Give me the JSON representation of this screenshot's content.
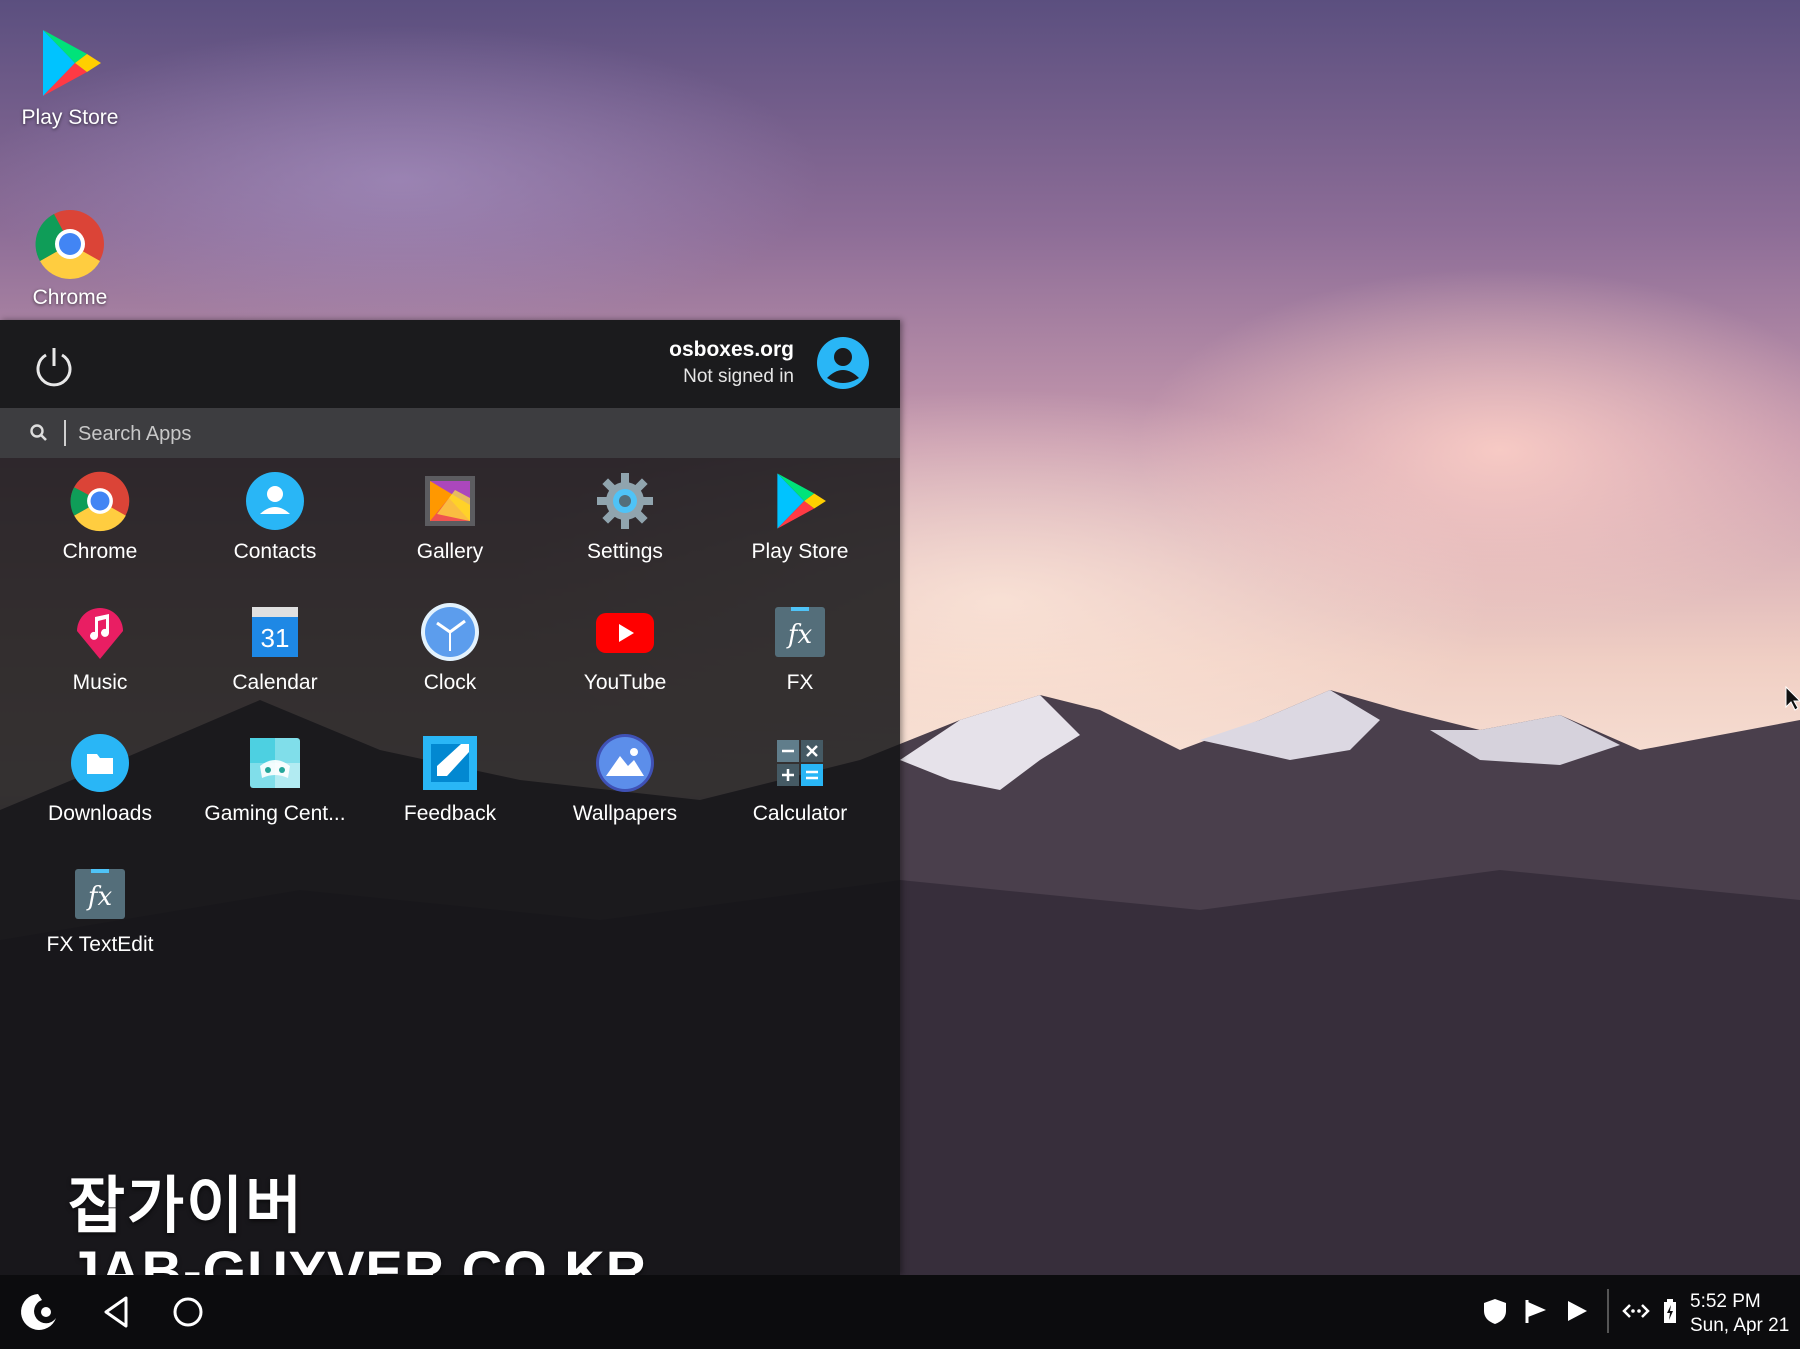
{
  "desktop": {
    "icons": [
      {
        "label": "Play Store",
        "icon": "play-store-icon"
      },
      {
        "label": "Chrome",
        "icon": "chrome-icon"
      }
    ]
  },
  "start_menu": {
    "user": {
      "name": "osboxes.org",
      "status": "Not signed in"
    },
    "search": {
      "placeholder": "Search Apps",
      "value": ""
    },
    "apps": [
      {
        "label": "Chrome",
        "icon": "chrome-icon"
      },
      {
        "label": "Contacts",
        "icon": "contacts-icon"
      },
      {
        "label": "Gallery",
        "icon": "gallery-icon"
      },
      {
        "label": "Settings",
        "icon": "settings-gear-icon"
      },
      {
        "label": "Play Store",
        "icon": "play-store-icon"
      },
      {
        "label": "Music",
        "icon": "music-icon"
      },
      {
        "label": "Calendar",
        "icon": "calendar-icon",
        "badge": "31"
      },
      {
        "label": "Clock",
        "icon": "clock-icon"
      },
      {
        "label": "YouTube",
        "icon": "youtube-icon"
      },
      {
        "label": "FX",
        "icon": "fx-icon"
      },
      {
        "label": "Downloads",
        "icon": "downloads-icon"
      },
      {
        "label": "Gaming Cent...",
        "icon": "gaming-center-icon"
      },
      {
        "label": "Feedback",
        "icon": "feedback-icon"
      },
      {
        "label": "Wallpapers",
        "icon": "wallpapers-icon"
      },
      {
        "label": "Calculator",
        "icon": "calculator-icon"
      },
      {
        "label": "FX TextEdit",
        "icon": "fx-textedit-icon"
      }
    ]
  },
  "watermark": {
    "line1": "잡가이버",
    "line2": "JAB-GUYVER.CO.KR"
  },
  "taskbar": {
    "clock": {
      "time": "5:52 PM",
      "date": "Sun, Apr 21"
    },
    "tray_icons": [
      "shield-icon",
      "flag-notification-icon",
      "play-notification-icon",
      "network-icon",
      "battery-icon"
    ]
  },
  "colors": {
    "accent": "#29b6f6",
    "menu_bg": "#1b1b1d",
    "search_bg": "#3d3d40",
    "taskbar_bg": "#0c0c0e"
  }
}
